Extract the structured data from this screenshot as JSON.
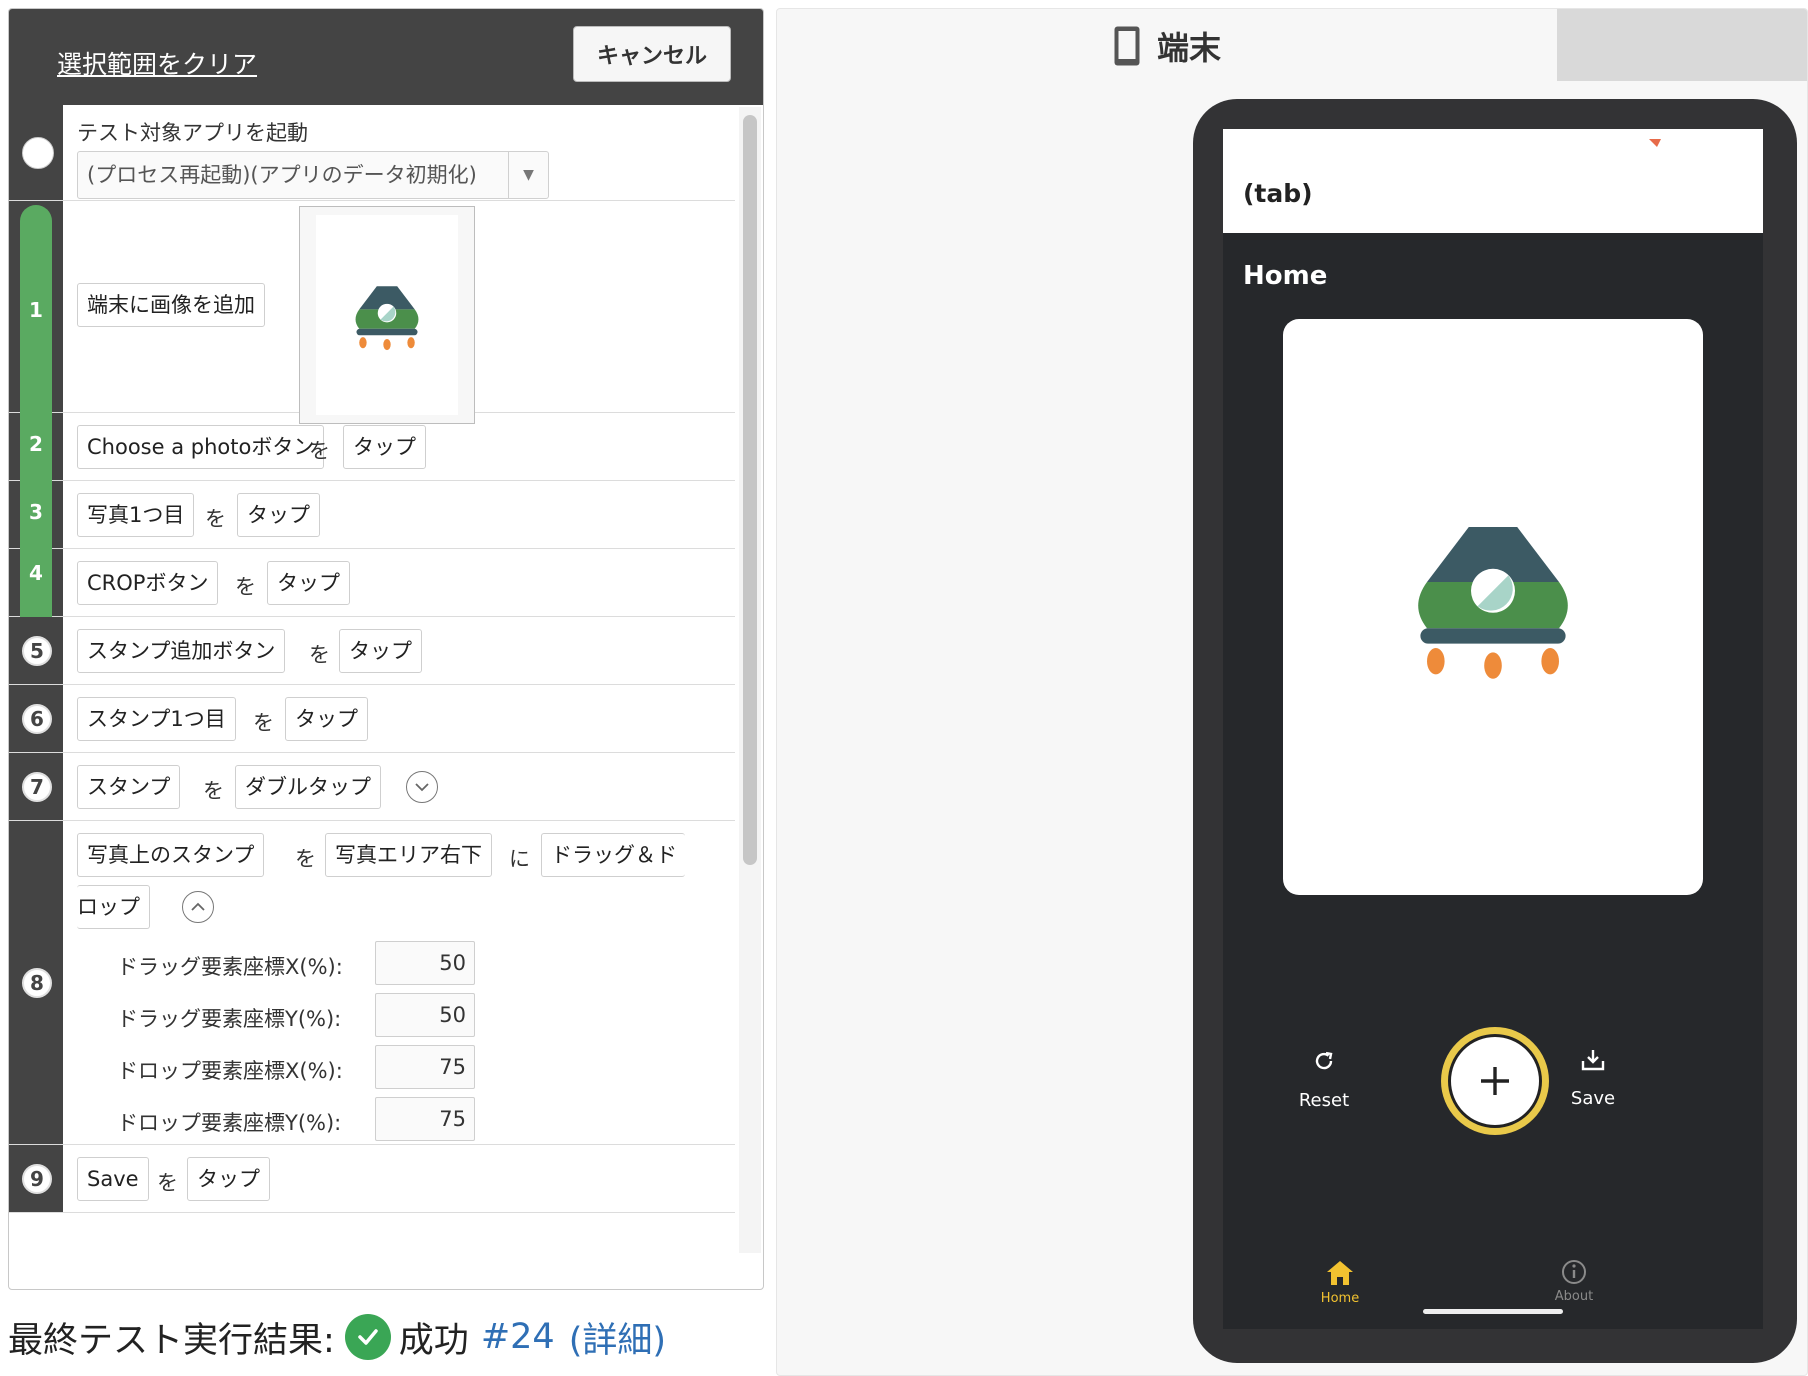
{
  "left": {
    "clear_selection": "選択範囲をクリア",
    "cancel": "キャンセル"
  },
  "steps": {
    "s0": {
      "title": "テスト対象アプリを起動",
      "option": "(プロセス再起動)(アプリのデータ初期化)"
    },
    "s1": {
      "num": "1",
      "action": "端末に画像を追加"
    },
    "s2": {
      "num": "2",
      "target": "Choose a photoボタン",
      "particle": "を",
      "action": "タップ"
    },
    "s3": {
      "num": "3",
      "target": "写真1つ目",
      "particle": "を",
      "action": "タップ"
    },
    "s4": {
      "num": "4",
      "target": "CROPボタン",
      "particle": "を",
      "action": "タップ"
    },
    "s5": {
      "num": "5",
      "target": "スタンプ追加ボタン",
      "particle": "を",
      "action": "タップ"
    },
    "s6": {
      "num": "6",
      "target": "スタンプ1つ目",
      "particle": "を",
      "action": "タップ"
    },
    "s7": {
      "num": "7",
      "target": "スタンプ",
      "particle": "を",
      "action": "ダブルタップ"
    },
    "s8": {
      "num": "8",
      "target": "写真上のスタンプ",
      "particle": "を",
      "dest": "写真エリア右下",
      "particle2": "に",
      "action_part1": "ドラッグ＆ド",
      "action_part2": "ロップ",
      "params": [
        {
          "label": "ドラッグ要素座標X(%):",
          "value": "50"
        },
        {
          "label": "ドラッグ要素座標Y(%):",
          "value": "50"
        },
        {
          "label": "ドロップ要素座標X(%):",
          "value": "75"
        },
        {
          "label": "ドロップ要素座標Y(%):",
          "value": "75"
        }
      ]
    },
    "s9": {
      "num": "9",
      "target": "Save",
      "particle": "を",
      "action": "タップ"
    }
  },
  "result": {
    "label": "最終テスト実行結果:",
    "status": "成功",
    "run": "#24",
    "detail": "(詳細)"
  },
  "device": {
    "title": "端末",
    "app_bar_title": "(tab)",
    "page_title": "Home",
    "actions": {
      "reset": "Reset",
      "save": "Save"
    },
    "nav": {
      "home": "Home",
      "about": "About"
    }
  },
  "colors": {
    "header_bg": "#444444",
    "step_green": "#5aaa61",
    "link_blue": "#2f6fb5",
    "success_green": "#3aa655",
    "fab_yellow": "#e9c94a",
    "nav_active": "#f2c230",
    "app_dark": "#26282b",
    "rocket_green": "#4b8f4b",
    "rocket_slate": "#3c5a64",
    "flame_orange": "#ee8b3a"
  }
}
